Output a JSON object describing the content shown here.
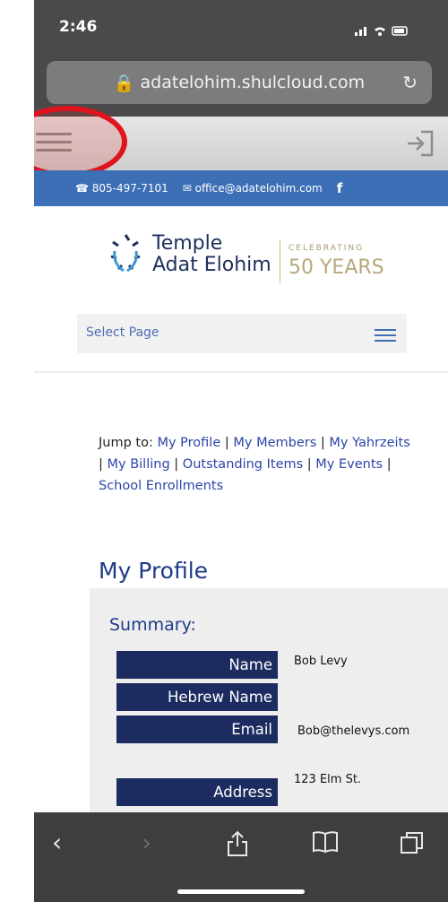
{
  "status": {
    "time": "2:46"
  },
  "browser": {
    "url": "adatelohim.shulcloud.com"
  },
  "contact": {
    "phone": "805-497-7101",
    "email": "office@adatelohim.com",
    "facebook": "f"
  },
  "logo": {
    "name_line1": "Temple",
    "name_line2": "Adat Elohim",
    "celebrating": "CELEBRATING",
    "years": "50 YEARS"
  },
  "nav": {
    "select_page": "Select Page"
  },
  "jump": {
    "prefix": "Jump to:",
    "links": [
      "My Profile",
      "My Members",
      "My Yahrzeits",
      "My Billing",
      "Outstanding Items",
      "My Events",
      "School Enrollments"
    ]
  },
  "profile": {
    "title": "My Profile",
    "summary_label": "Summary:",
    "fields": [
      {
        "label": "Name",
        "value": "Bob Levy"
      },
      {
        "label": "Hebrew Name",
        "value": ""
      },
      {
        "label": "Email",
        "value": "Bob@thelevys.com"
      },
      {
        "label": "Address",
        "value": "123 Elm St."
      }
    ]
  },
  "colors": {
    "accent": "#3d6fb6",
    "navy": "#1c2c60",
    "highlight": "#e0141e"
  }
}
